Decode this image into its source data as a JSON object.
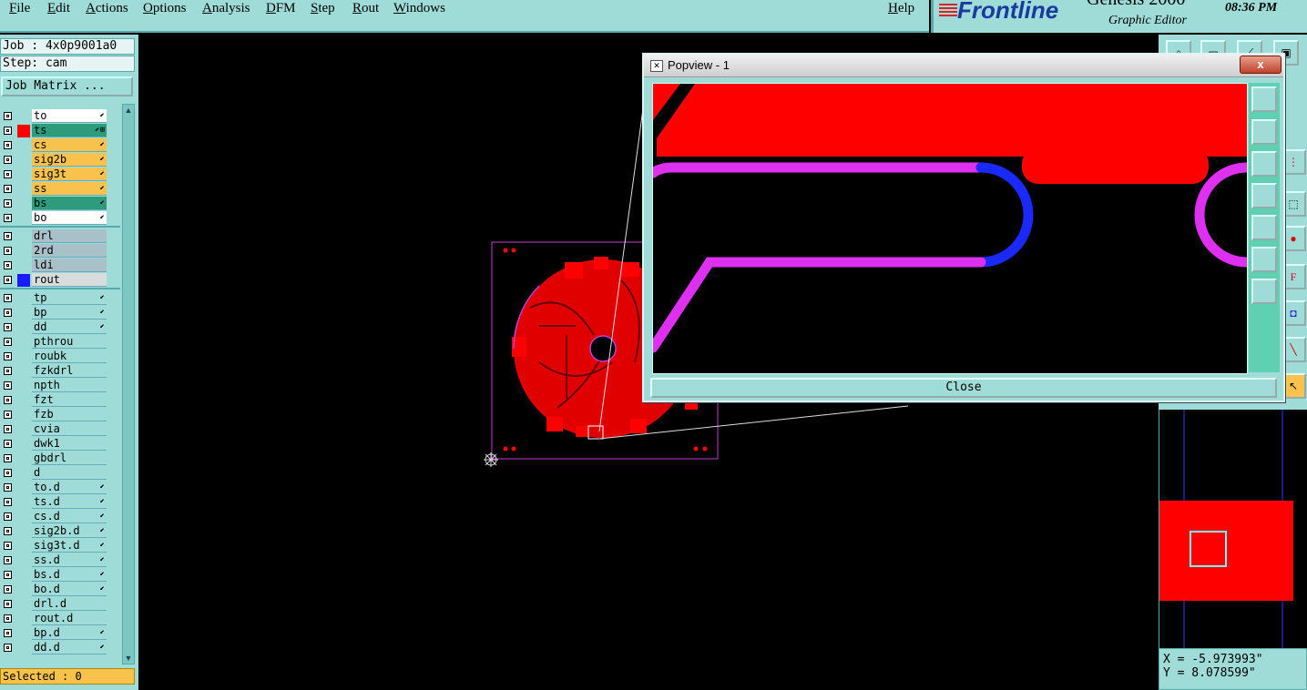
{
  "menu": {
    "items": [
      "File",
      "Edit",
      "Actions",
      "Options",
      "Analysis",
      "DFM",
      "Step",
      "Rout",
      "Windows"
    ],
    "help": "Help"
  },
  "brand": {
    "logo": "Frontline",
    "product": "Genesis 2000",
    "subtitle": "Graphic Editor",
    "clock": "08:36 PM"
  },
  "job": {
    "job_line": "Job : 4x0p9001a0",
    "step_line": "Step: cam",
    "job_matrix_button": "Job Matrix ..."
  },
  "layers": {
    "board": [
      {
        "name": "to",
        "color": "#ffffff",
        "swatch": "",
        "icon": "⬋"
      },
      {
        "name": "ts",
        "color": "#2e9b7a",
        "swatch": "#ff0000",
        "icon": "⬋⊞",
        "active": true
      },
      {
        "name": "cs",
        "color": "#f9c24c",
        "swatch": "",
        "icon": "⬋"
      },
      {
        "name": "sig2b",
        "color": "#f9c24c",
        "swatch": "",
        "icon": "⬋"
      },
      {
        "name": "sig3t",
        "color": "#f9c24c",
        "swatch": "",
        "icon": "⬋"
      },
      {
        "name": "ss",
        "color": "#f9c24c",
        "swatch": "",
        "icon": "⬋"
      },
      {
        "name": "bs",
        "color": "#2e9b7a",
        "swatch": "",
        "icon": "⬋"
      },
      {
        "name": "bo",
        "color": "#ffffff",
        "swatch": "",
        "icon": "⬋"
      }
    ],
    "drill": [
      {
        "name": "drl",
        "color": "#a8c0c8",
        "swatch": "",
        "icon": ""
      },
      {
        "name": "2rd",
        "color": "#a8c0c8",
        "swatch": "",
        "icon": ""
      },
      {
        "name": "ldi",
        "color": "#a8c0c8",
        "swatch": "",
        "icon": ""
      },
      {
        "name": "rout",
        "color": "#d8dcdc",
        "swatch": "#1a1aff",
        "icon": ""
      }
    ],
    "misc": [
      {
        "name": "tp",
        "icon": "⬋"
      },
      {
        "name": "bp",
        "icon": "⬋"
      },
      {
        "name": "dd",
        "icon": "⬋"
      },
      {
        "name": "pthrou",
        "icon": ""
      },
      {
        "name": "roubk",
        "icon": ""
      },
      {
        "name": "fzkdrl",
        "icon": ""
      },
      {
        "name": "npth",
        "icon": ""
      },
      {
        "name": "fzt",
        "icon": ""
      },
      {
        "name": "fzb",
        "icon": ""
      },
      {
        "name": "cvia",
        "icon": ""
      },
      {
        "name": "dwk1",
        "icon": ""
      },
      {
        "name": "gbdrl",
        "icon": ""
      },
      {
        "name": "d",
        "icon": ""
      },
      {
        "name": "to.d",
        "icon": "⬋"
      },
      {
        "name": "ts.d",
        "icon": "⬋"
      },
      {
        "name": "cs.d",
        "icon": "⬋"
      },
      {
        "name": "sig2b.d",
        "icon": "⬋"
      },
      {
        "name": "sig3t.d",
        "icon": "⬋"
      },
      {
        "name": "ss.d",
        "icon": "⬋"
      },
      {
        "name": "bs.d",
        "icon": "⬋"
      },
      {
        "name": "bo.d",
        "icon": "⬋"
      },
      {
        "name": "drl.d",
        "icon": ""
      },
      {
        "name": "rout.d",
        "icon": ""
      },
      {
        "name": "bp.d",
        "icon": "⬋"
      },
      {
        "name": "dd.d",
        "icon": "⬋"
      }
    ]
  },
  "status": {
    "selected": "Selected : 0"
  },
  "coords": {
    "x": "X = -5.973993\"",
    "y": "Y = 8.078599\""
  },
  "popview": {
    "title": "Popview - 1",
    "close_x": "x",
    "close_button": "Close"
  },
  "colors": {
    "panel": "#9fdcd8",
    "copper": "#ff0000",
    "trace_magenta": "#dd30f0",
    "trace_blue": "#1a2aff",
    "outline": "#c040d0"
  }
}
